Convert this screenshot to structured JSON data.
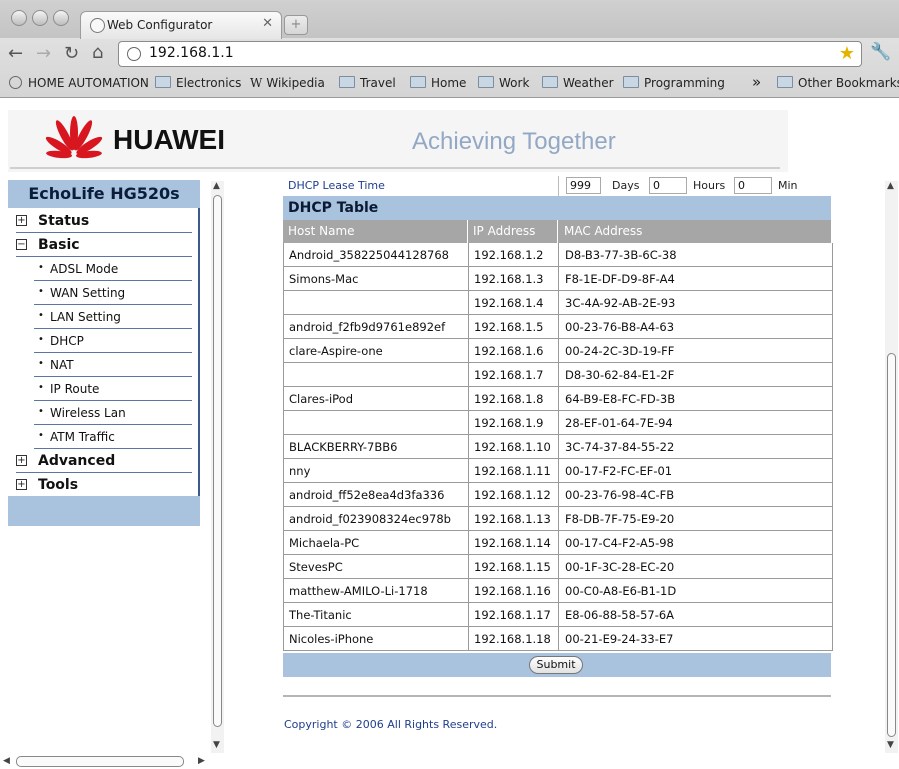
{
  "browser": {
    "tab_title": "Web Configurator",
    "url": "192.168.1.1",
    "bookmarks": [
      {
        "label": "HOME AUTOMATION"
      },
      {
        "label": "Electronics"
      },
      {
        "label": "Wikipedia"
      },
      {
        "label": "Travel"
      },
      {
        "label": "Home"
      },
      {
        "label": "Work"
      },
      {
        "label": "Weather"
      },
      {
        "label": "Programming"
      },
      {
        "label": "Other Bookmarks"
      }
    ],
    "overflow": "»"
  },
  "header": {
    "brand": "HUAWEI",
    "tagline": "Achieving Together"
  },
  "sidebar": {
    "title": "EchoLife HG520s",
    "status": "Status",
    "basic": "Basic",
    "sub_items": [
      "ADSL Mode",
      "WAN Setting",
      "LAN Setting",
      "DHCP",
      "NAT",
      "IP Route",
      "Wireless Lan",
      "ATM Traffic"
    ],
    "advanced": "Advanced",
    "tools": "Tools"
  },
  "lease": {
    "label": "DHCP Lease Time",
    "days_value": "999",
    "days_label": "Days",
    "hours_value": "0",
    "hours_label": "Hours",
    "min_value": "0",
    "min_label": "Min"
  },
  "dhcp_table": {
    "title": "DHCP Table",
    "columns": [
      "Host Name",
      "IP Address",
      "MAC Address"
    ],
    "rows": [
      [
        "Android_358225044128768",
        "192.168.1.2",
        "D8-B3-77-3B-6C-38"
      ],
      [
        "Simons-Mac",
        "192.168.1.3",
        "F8-1E-DF-D9-8F-A4"
      ],
      [
        "",
        "192.168.1.4",
        "3C-4A-92-AB-2E-93"
      ],
      [
        "android_f2fb9d9761e892ef",
        "192.168.1.5",
        "00-23-76-B8-A4-63"
      ],
      [
        "clare-Aspire-one",
        "192.168.1.6",
        "00-24-2C-3D-19-FF"
      ],
      [
        "",
        "192.168.1.7",
        "D8-30-62-84-E1-2F"
      ],
      [
        "Clares-iPod",
        "192.168.1.8",
        "64-B9-E8-FC-FD-3B"
      ],
      [
        "",
        "192.168.1.9",
        "28-EF-01-64-7E-94"
      ],
      [
        "BLACKBERRY-7BB6",
        "192.168.1.10",
        "3C-74-37-84-55-22"
      ],
      [
        "nny",
        "192.168.1.11",
        "00-17-F2-FC-EF-01"
      ],
      [
        "android_ff52e8ea4d3fa336",
        "192.168.1.12",
        "00-23-76-98-4C-FB"
      ],
      [
        "android_f023908324ec978b",
        "192.168.1.13",
        "F8-DB-7F-75-E9-20"
      ],
      [
        "Michaela-PC",
        "192.168.1.14",
        "00-17-C4-F2-A5-98"
      ],
      [
        "StevesPC",
        "192.168.1.15",
        "00-1F-3C-28-EC-20"
      ],
      [
        "matthew-AMILO-Li-1718",
        "192.168.1.16",
        "00-C0-A8-E6-B1-1D"
      ],
      [
        "The-Titanic",
        "192.168.1.17",
        "E8-06-88-58-57-6A"
      ],
      [
        "Nicoles-iPhone",
        "192.168.1.18",
        "00-21-E9-24-33-E7"
      ]
    ]
  },
  "submit_label": "Submit",
  "copyright": "Copyright © 2006 All Rights Reserved.",
  "colors": {
    "accent": "#a9c3df",
    "header_gray": "#a6a6a6",
    "link_blue": "#1f3e8c"
  }
}
